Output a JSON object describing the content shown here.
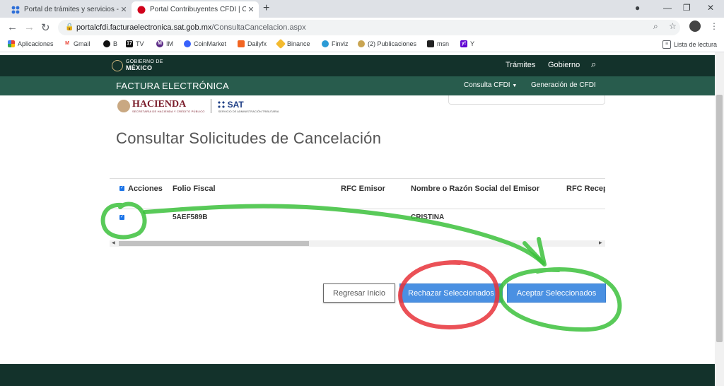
{
  "browser": {
    "tabs": [
      {
        "title": "Portal de trámites y servicios - SAT",
        "active": false
      },
      {
        "title": "Portal Contribuyentes CFDI | Cancelación",
        "active": true
      }
    ],
    "url_host": "portalcfdi.facturaelectronica.sat.gob.mx",
    "url_path": "/ConsultaCancelacion.aspx",
    "bookmarks": [
      "Aplicaciones",
      "Gmail",
      "B",
      "TV",
      "IM",
      "CoinMarket",
      "Dailyfx",
      "Binance",
      "Finviz",
      "(2) Publicaciones",
      "msn",
      "Y"
    ],
    "reading_list": "Lista de lectura"
  },
  "gob": {
    "logo_top": "GOBIERNO DE",
    "logo_main": "MÉXICO",
    "nav": [
      "Trámites",
      "Gobierno"
    ]
  },
  "fe": {
    "title": "FACTURA ELECTRÓNICA",
    "nav_consulta": "Consulta CFDI",
    "nav_generacion": "Generación de CFDI"
  },
  "logos": {
    "hacienda": "HACIENDA",
    "hacienda_sub": "SECRETARÍA DE HACIENDA Y CRÉDITO PÚBLICO",
    "sat": "SAT",
    "sat_sub": "SERVICIO DE ADMINISTRACIÓN TRIBUTARIA"
  },
  "page": {
    "title": "Consultar Solicitudes de Cancelación"
  },
  "table": {
    "columns": [
      "Acciones",
      "Folio Fiscal",
      "RFC Emisor",
      "Nombre o Razón Social del Emisor",
      "RFC Recep"
    ],
    "rows": [
      {
        "checked": true,
        "folio": "5AEF589B",
        "rfc_emisor": "",
        "nombre": "CRISTINA",
        "rfc_receptor": ""
      }
    ]
  },
  "buttons": {
    "regresar": "Regresar Inicio",
    "rechazar": "Rechazar Seleccionados",
    "aceptar": "Aceptar Seleccionados"
  },
  "colors": {
    "gob_dark": "#13322b",
    "fe_green": "#285c4d",
    "primary_button": "#4a90e2",
    "annotation_green": "#3cc13c",
    "annotation_red": "#e8323a"
  }
}
